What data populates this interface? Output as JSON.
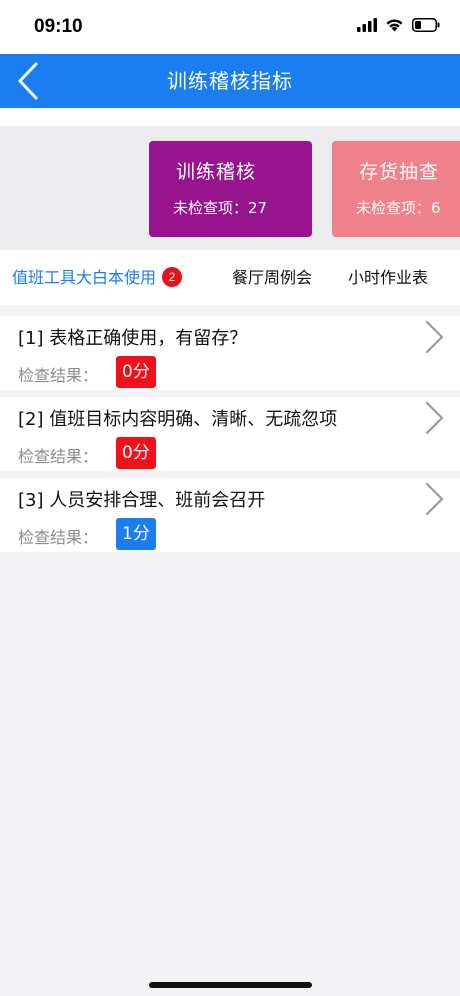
{
  "status_bar": {
    "time": "09:10",
    "icons": [
      "signal-icon",
      "wifi-icon",
      "battery-icon"
    ]
  },
  "nav": {
    "title": "训练稽核指标",
    "back_icon": "chevron-left-icon"
  },
  "cards": [
    {
      "title": "训练稽核",
      "subtitle": "未检查项：27",
      "color": "#98138e"
    },
    {
      "title": "存货抽查",
      "subtitle": "未检查项：6",
      "color": "#ee8189"
    }
  ],
  "tabs": [
    {
      "label": "值班工具大白本使用",
      "badge": "2",
      "active": true
    },
    {
      "label": "餐厅周例会",
      "active": false
    },
    {
      "label": "小时作业表",
      "active": false
    }
  ],
  "items": [
    {
      "title": "[1] 表格正确使用，有留存？",
      "result_label": "检查结果：",
      "score": "0分",
      "score_color": "#f2101a"
    },
    {
      "title": "[2] 值班目标内容明确、清晰、无疏忽项",
      "result_label": "检查结果：",
      "score": "0分",
      "score_color": "#f2101a"
    },
    {
      "title": "[3] 人员安排合理、班前会召开",
      "result_label": "检查结果：",
      "score": "1分",
      "score_color": "#1a7ef0"
    }
  ],
  "colors": {
    "accent": "#1a7ef0",
    "badge": "#e3131b"
  }
}
